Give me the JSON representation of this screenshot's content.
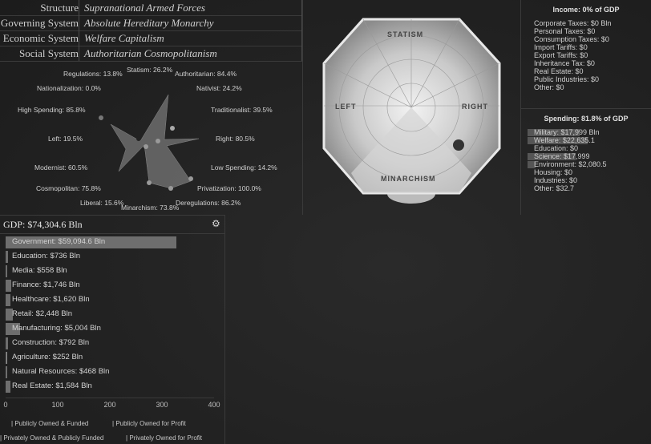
{
  "info": {
    "rows": [
      {
        "label": "Structure",
        "value": "Supranational Armed Forces"
      },
      {
        "label": "Governing System",
        "value": "Absolute Hereditary Monarchy"
      },
      {
        "label": "Economic System",
        "value": "Welfare Capitalism"
      },
      {
        "label": "Social System",
        "value": "Authoritarian Cosmopolitanism"
      }
    ]
  },
  "radar": {
    "labels": {
      "regulations": "Regulations: 13.8%",
      "statism": "Statism: 26.2%",
      "authoritarian": "Authoritarian: 84.4%",
      "nationalization": "Nationalization: 0.0%",
      "nativist": "Nativist: 24.2%",
      "high_spending": "High Spending: 85.8%",
      "traditionalist": "Traditionalist: 39.5%",
      "left": "Left: 19.5%",
      "right": "Right: 80.5%",
      "modernist": "Modernist: 60.5%",
      "low_spending": "Low Spending: 14.2%",
      "cosmopolitan": "Cosmopolitan: 75.8%",
      "privatization": "Privatization: 100.0%",
      "liberal": "Liberal: 15.6%",
      "minarchism": "Minarchism: 73.8%",
      "deregulations": "Deregulations: 86.2%"
    }
  },
  "compass": {
    "top": "STATISM",
    "left": "LEFT",
    "right": "RIGHT",
    "bottom": "MINARCHISM"
  },
  "income": {
    "title": "Income: 0% of GDP",
    "items": [
      "Corporate Taxes: $0 Bln",
      "Personal Taxes: $0",
      "Consumption Taxes: $0",
      "Import Tariffs: $0",
      "Export Tariffs: $0",
      "Inheritance Tax: $0",
      "Real Estate: $0",
      "Public Industries: $0",
      "Other: $0"
    ]
  },
  "spending": {
    "title": "Spending: 81.8% of GDP",
    "items": [
      {
        "label": "Military: $17,999 Bln",
        "bar": 0.65
      },
      {
        "label": "Welfare: $22,635.1",
        "bar": 0.75
      },
      {
        "label": "Education: $0",
        "bar": 0
      },
      {
        "label": "Science: $17,999",
        "bar": 0.6
      },
      {
        "label": "Environment: $2,080.5",
        "bar": 0.08
      },
      {
        "label": "Housing: $0",
        "bar": 0
      },
      {
        "label": "Industries: $0",
        "bar": 0
      },
      {
        "label": "Other: $32.7",
        "bar": 0
      }
    ]
  },
  "gdp": {
    "title": "GDP: $74,304.6 Bln",
    "max": 400,
    "rows": [
      {
        "label": "Government: $59,094.6 Bln",
        "value": 328
      },
      {
        "label": "Education: $736 Bln",
        "value": 4
      },
      {
        "label": "Media: $558 Bln",
        "value": 3
      },
      {
        "label": "Finance: $1,746 Bln",
        "value": 10
      },
      {
        "label": "Healthcare: $1,620 Bln",
        "value": 9
      },
      {
        "label": "Retail: $2,448 Bln",
        "value": 14
      },
      {
        "label": "Manufacturing: $5,004 Bln",
        "value": 28
      },
      {
        "label": "Construction: $792 Bln",
        "value": 4
      },
      {
        "label": "Agriculture: $252 Bln",
        "value": 1
      },
      {
        "label": "Natural Resources: $468 Bln",
        "value": 3
      },
      {
        "label": "Real Estate: $1,584 Bln",
        "value": 9
      }
    ],
    "axis_ticks": [
      "0",
      "100",
      "200",
      "300",
      "400"
    ],
    "legend": [
      "Publicly Owned & Funded",
      "Publicly Owned for Profit",
      "Privately Owned & Publicly Funded",
      "Privately Owned for Profit"
    ]
  }
}
